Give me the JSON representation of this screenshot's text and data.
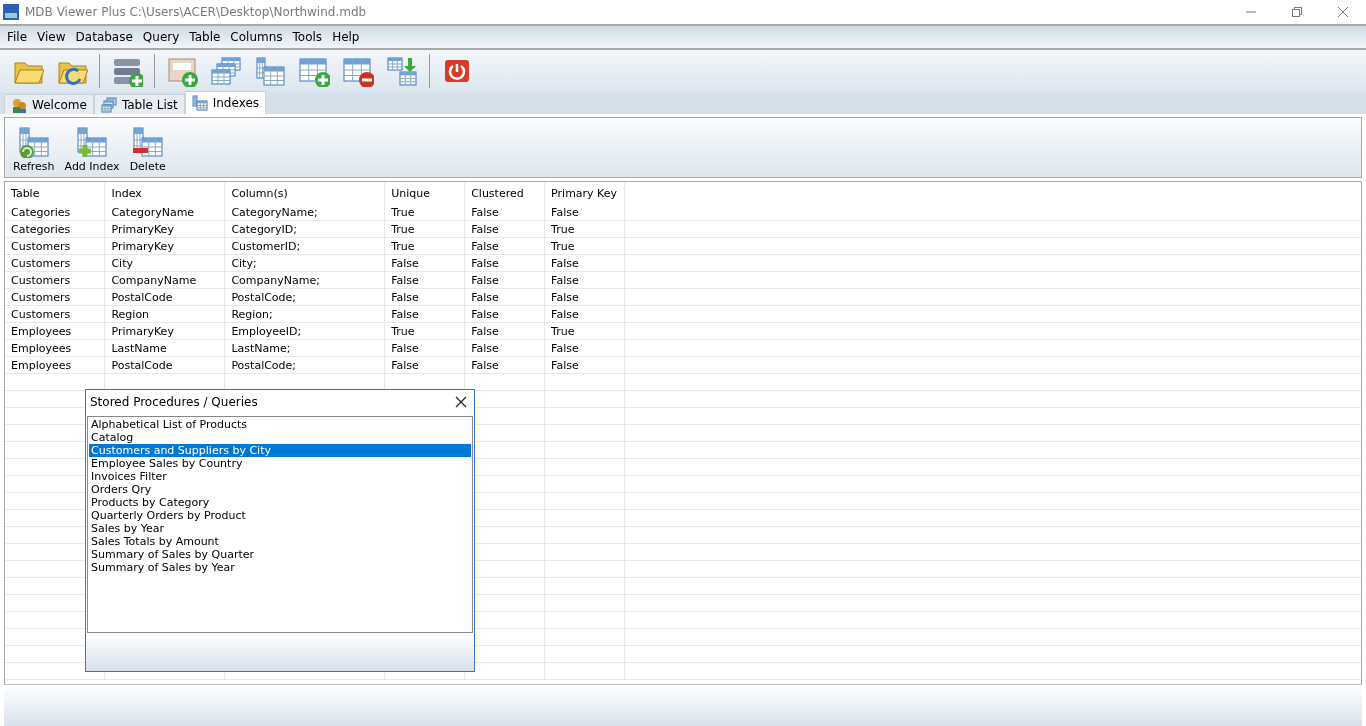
{
  "window": {
    "title": "MDB Viewer Plus C:\\Users\\ACER\\Desktop\\Northwind.mdb"
  },
  "menu": [
    "File",
    "View",
    "Database",
    "Query",
    "Table",
    "Columns",
    "Tools",
    "Help"
  ],
  "toolbar": [
    {
      "kind": "open-folder"
    },
    {
      "kind": "reload-folder"
    },
    {
      "kind": "sep"
    },
    {
      "kind": "db-add"
    },
    {
      "kind": "sep"
    },
    {
      "kind": "sql-add"
    },
    {
      "kind": "tables"
    },
    {
      "kind": "table-index"
    },
    {
      "kind": "table-add"
    },
    {
      "kind": "table-remove"
    },
    {
      "kind": "rename"
    },
    {
      "kind": "sep"
    },
    {
      "kind": "power"
    }
  ],
  "tabs": [
    {
      "label": "Welcome",
      "kind": "users",
      "selected": false
    },
    {
      "label": "Table List",
      "kind": "tables",
      "selected": false
    },
    {
      "label": "Indexes",
      "kind": "index",
      "selected": true
    }
  ],
  "actions": [
    {
      "label": "Refresh",
      "kind": "refresh"
    },
    {
      "label": "Add Index",
      "kind": "add"
    },
    {
      "label": "Delete",
      "kind": "delete"
    }
  ],
  "table": {
    "columns": [
      "Table",
      "Index",
      "Column(s)",
      "Unique",
      "Clustered",
      "Primary Key"
    ],
    "rows": [
      [
        "Categories",
        "CategoryName",
        "CategoryName;",
        "True",
        "False",
        "False"
      ],
      [
        "Categories",
        "PrimaryKey",
        "CategoryID;",
        "True",
        "False",
        "True"
      ],
      [
        "Customers",
        "PrimaryKey",
        "CustomerID;",
        "True",
        "False",
        "True"
      ],
      [
        "Customers",
        "City",
        "City;",
        "False",
        "False",
        "False"
      ],
      [
        "Customers",
        "CompanyName",
        "CompanyName;",
        "False",
        "False",
        "False"
      ],
      [
        "Customers",
        "PostalCode",
        "PostalCode;",
        "False",
        "False",
        "False"
      ],
      [
        "Customers",
        "Region",
        "Region;",
        "False",
        "False",
        "False"
      ],
      [
        "Employees",
        "PrimaryKey",
        "EmployeeID;",
        "True",
        "False",
        "True"
      ],
      [
        "Employees",
        "LastName",
        "LastName;",
        "False",
        "False",
        "False"
      ],
      [
        "Employees",
        "PostalCode",
        "PostalCode;",
        "False",
        "False",
        "False"
      ]
    ]
  },
  "dialog": {
    "title": "Stored Procedures / Queries",
    "items": [
      {
        "label": "Alphabetical List of Products",
        "selected": false
      },
      {
        "label": "Catalog",
        "selected": false
      },
      {
        "label": "Customers and Suppliers by City",
        "selected": true
      },
      {
        "label": "Employee Sales by Country",
        "selected": false
      },
      {
        "label": "Invoices Filter",
        "selected": false
      },
      {
        "label": "Orders Qry",
        "selected": false
      },
      {
        "label": "Products by Category",
        "selected": false
      },
      {
        "label": "Quarterly Orders by Product",
        "selected": false
      },
      {
        "label": "Sales by Year",
        "selected": false
      },
      {
        "label": "Sales Totals by Amount",
        "selected": false
      },
      {
        "label": "Summary of Sales by Quarter",
        "selected": false
      },
      {
        "label": "Summary of Sales by Year",
        "selected": false
      }
    ]
  }
}
